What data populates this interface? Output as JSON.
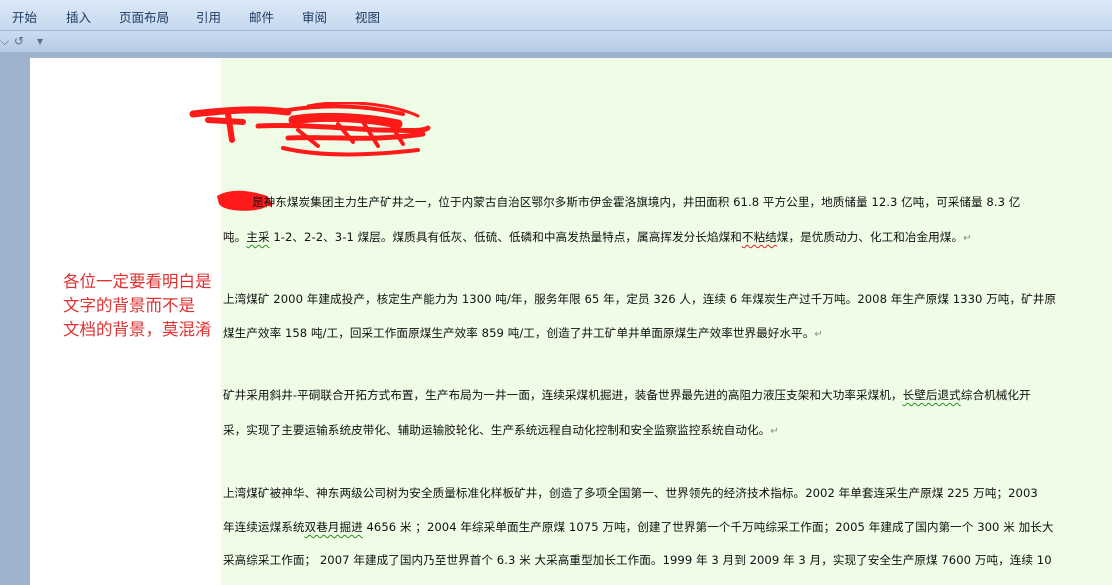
{
  "ribbon": {
    "tabs": [
      "开始",
      "插入",
      "页面布局",
      "引用",
      "邮件",
      "审阅",
      "视图"
    ]
  },
  "quick_access": {
    "undo_icon": "↺",
    "more_icon": "▾"
  },
  "document": {
    "lines": [
      {
        "text": "是神东煤炭集团主力生产矿井之一，位于内蒙古自治区鄂尔多斯市伊金霍洛旗境内，井田面积 61.8 平方公里，地质储量 12.3 亿吨，可采储量 8.3 亿"
      },
      {
        "text_a": "吨。",
        "text_b": "主采",
        "text_c": " 1-2、2-2、3-1 煤层。煤质具有低灰、低硫、低磷和中高发热量特点，属高挥发分长焰煤和",
        "text_d": "不粘结",
        "text_e": "煤，是优质动力、化工和冶金用煤。"
      },
      {
        "text": "上湾煤矿 2000 年建成投产，核定生产能力为 1300 吨/年，服务年限 65 年，定员 326 人，连续 6 年煤炭生产过千万吨。2008 年生产原煤 1330 万吨，矿井原"
      },
      {
        "text": "煤生产效率 158 吨/工，回采工作面原煤生产效率 859 吨/工，创造了井工矿单井单面原煤生产效率世界最好水平。"
      },
      {
        "text_a": "矿井采用斜井-平硐联合开拓方式布置，生产布局为一井一面，连续采煤机掘进，装备世界最先进的高阻力液压支架和大功率采煤机，",
        "text_b": "长壁后退式",
        "text_c": "综合机械化开"
      },
      {
        "text": "采，实现了主要运输系统皮带化、辅助运输胶轮化、生产系统远程自动化控制和安全监察监控系统自动化。"
      },
      {
        "text": "上湾煤矿被神华、神东两级公司树为安全质量标准化样板矿井，创造了多项全国第一、世界领先的经济技术指标。2002 年单套连采生产原煤 225 万吨；2003"
      },
      {
        "text_a": "年连续运煤系统",
        "text_b": "双巷月掘进",
        "text_c": " 4656 米 ；2004 年综采单面生产原煤 1075 万吨，创建了世界第一个千万吨综采工作面；2005 年建成了国内第一个 300 米  加长大"
      },
      {
        "text": "采高综采工作面； 2007 年建成了国内乃至世界首个 6.3 米 大采高重型加长工作面。1999 年 3 月到 2009 年 3 月，实现了安全生产原煤 7600 万吨，连续 10"
      }
    ],
    "paragraph_mark": "↵"
  },
  "annotation": {
    "lines": [
      "各位一定要看明白是",
      "文字的背景而不是",
      "文档的背景，莫混淆"
    ],
    "color": "#e03131"
  },
  "colors": {
    "text_background": "#f0fde6",
    "scribble": "#ff1a1a"
  }
}
